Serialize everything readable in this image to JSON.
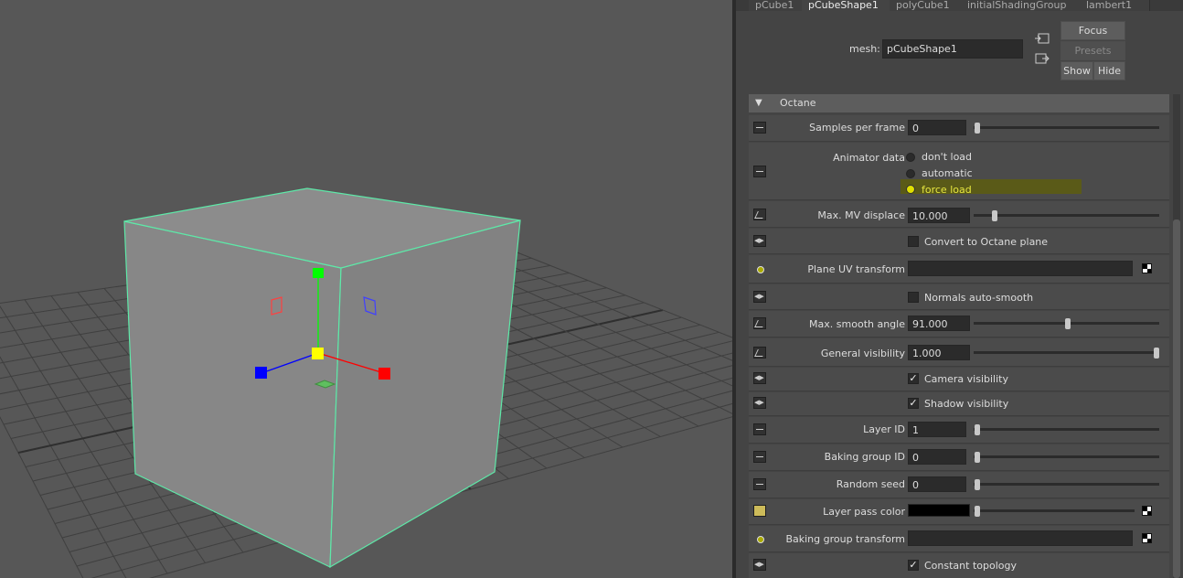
{
  "tabs": [
    "pCube1",
    "pCubeShape1",
    "polyCube1",
    "initialShadingGroup",
    "lambert1"
  ],
  "active_tab": "pCubeShape1",
  "header": {
    "mesh_label": "mesh:",
    "mesh_value": "pCubeShape1",
    "focus": "Focus",
    "presets": "Presets",
    "show": "Show",
    "hide": "Hide"
  },
  "section": {
    "title": "Octane"
  },
  "attributes": {
    "samples_per_frame": {
      "label": "Samples per frame",
      "value": "0"
    },
    "animator_data": {
      "label": "Animator data",
      "options": [
        "don't load",
        "automatic",
        "force load"
      ],
      "selected": "force load"
    },
    "max_mv_displace": {
      "label": "Max. MV displace",
      "value": "10.000"
    },
    "convert_to_octane_plane": {
      "label": "Convert to Octane plane",
      "checked": false
    },
    "plane_uv_transform": {
      "label": "Plane UV transform"
    },
    "normals_auto_smooth": {
      "label": "Normals auto-smooth",
      "checked": false
    },
    "max_smooth_angle": {
      "label": "Max. smooth angle",
      "value": "91.000"
    },
    "general_visibility": {
      "label": "General visibility",
      "value": "1.000"
    },
    "camera_visibility": {
      "label": "Camera visibility",
      "checked": true
    },
    "shadow_visibility": {
      "label": "Shadow visibility",
      "checked": true
    },
    "layer_id": {
      "label": "Layer ID",
      "value": "1"
    },
    "baking_group_id": {
      "label": "Baking group ID",
      "value": "0"
    },
    "random_seed": {
      "label": "Random seed",
      "value": "0"
    },
    "layer_pass_color": {
      "label": "Layer pass color",
      "color": "#000000"
    },
    "baking_group_transform": {
      "label": "Baking group transform"
    },
    "constant_topology": {
      "label": "Constant topology",
      "checked": true
    }
  },
  "colors": {
    "wireframe_highlight": "#5ee8a8",
    "radio_selected": "#e0e000",
    "manipulator_x": "#ff0000",
    "manipulator_y": "#00ff00",
    "manipulator_z": "#0000ff",
    "manipulator_center": "#ffff00"
  },
  "icons": {
    "move_manipulator": "translate-manipulator-icon",
    "texture_map": "checker-icon",
    "side_buttons": [
      "copy-tab-icon",
      "load-selected-icon"
    ]
  }
}
